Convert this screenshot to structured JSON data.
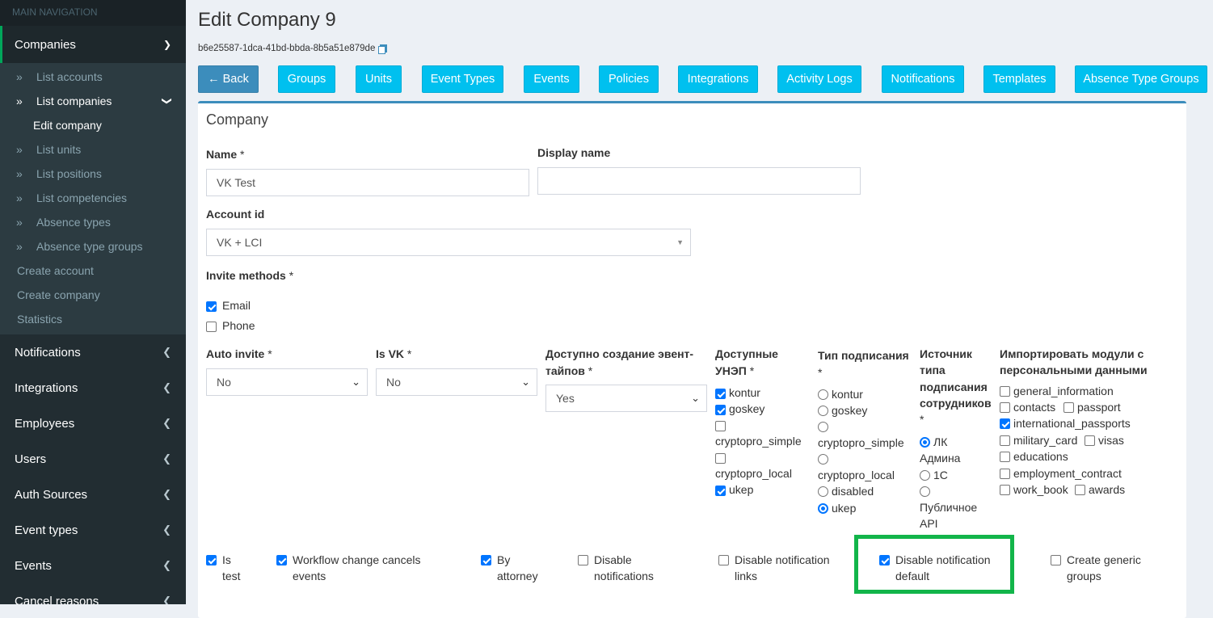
{
  "sidebar": {
    "header": "MAIN NAVIGATION",
    "companies": "Companies",
    "sub": [
      {
        "label": "List accounts"
      },
      {
        "label": "List companies"
      },
      {
        "label": "Edit company"
      },
      {
        "label": "List units"
      },
      {
        "label": "List positions"
      },
      {
        "label": "List competencies"
      },
      {
        "label": "Absence types"
      },
      {
        "label": "Absence type groups"
      },
      {
        "label": "Create account"
      },
      {
        "label": "Create company"
      },
      {
        "label": "Statistics"
      }
    ],
    "menu": [
      {
        "label": "Notifications"
      },
      {
        "label": "Integrations"
      },
      {
        "label": "Employees"
      },
      {
        "label": "Users"
      },
      {
        "label": "Auth Sources"
      },
      {
        "label": "Event types"
      },
      {
        "label": "Events"
      },
      {
        "label": "Cancel reasons"
      }
    ]
  },
  "page": {
    "title": "Edit Company 9",
    "uuid": "b6e25587-1dca-41bd-bbda-8b5a51e879de"
  },
  "buttons": {
    "back": "← Back",
    "groups": "Groups",
    "units": "Units",
    "event_types": "Event Types",
    "events": "Events",
    "policies": "Policies",
    "integrations": "Integrations",
    "activity_logs": "Activity Logs",
    "notifications": "Notifications",
    "templates": "Templates",
    "absence_type_groups": "Absence Type Groups"
  },
  "form": {
    "box_title": "Company",
    "required_mark": "*",
    "name_label": "Name",
    "name_value": "VK Test",
    "display_name_label": "Display name",
    "display_name_value": "",
    "account_label": "Account id",
    "account_value": "VK + LCI",
    "invite_label": "Invite methods",
    "invite_email": "Email",
    "invite_phone": "Phone",
    "auto_invite_label": "Auto invite",
    "auto_invite_value": "No",
    "is_vk_label": "Is VK",
    "is_vk_value": "No",
    "event_create_label_1": "Доступно создание эвент-",
    "event_create_label_2": "тайпов",
    "event_create_value": "Yes",
    "unep_label_1": "Доступные",
    "unep_label_2": "УНЭП",
    "unep": [
      "kontur",
      "goskey",
      "cryptopro_simple",
      "cryptopro_local",
      "ukep"
    ],
    "sign_type_label": "Тип подписания",
    "sign_types": [
      "kontur",
      "goskey",
      "cryptopro_simple",
      "cryptopro_local",
      "disabled",
      "ukep"
    ],
    "source_label_1": "Источник",
    "source_label_2": "типа",
    "source_label_3": "подписания",
    "source_label_4": "сотрудников",
    "source_1a": "ЛК",
    "source_1b": "Админа",
    "source_2": "1С",
    "source_3a": "Публичное",
    "source_3b": "API",
    "import_label_1": "Импортировать модули с",
    "import_label_2": "персональными данными",
    "modules": {
      "general_information": "general_information",
      "contacts": "contacts",
      "passport": "passport",
      "international_passports": "international_passports",
      "military_card": "military_card",
      "visas": "visas",
      "educations": "educations",
      "employment_contract": "employment_contract",
      "work_book": "work_book",
      "awards": "awards"
    },
    "bottom": {
      "is_test_1": "Is",
      "is_test_2": "test",
      "workflow_1": "Workflow change cancels",
      "workflow_2": "events",
      "by_attorney_1": "By",
      "by_attorney_2": "attorney",
      "disable_notif_1": "Disable",
      "disable_notif_2": "notifications",
      "disable_links_1": "Disable notification",
      "disable_links_2": "links",
      "disable_default_1": "Disable notification",
      "disable_default_2": "default",
      "create_generic_1": "Create generic",
      "create_generic_2": "groups"
    }
  },
  "colors": {
    "sidebar_bg": "#222d32",
    "accent_blue": "#3c8dbc",
    "button_cyan": "#00c0ef",
    "highlight_green": "#12b54a",
    "checkbox_blue": "#0075ff"
  }
}
